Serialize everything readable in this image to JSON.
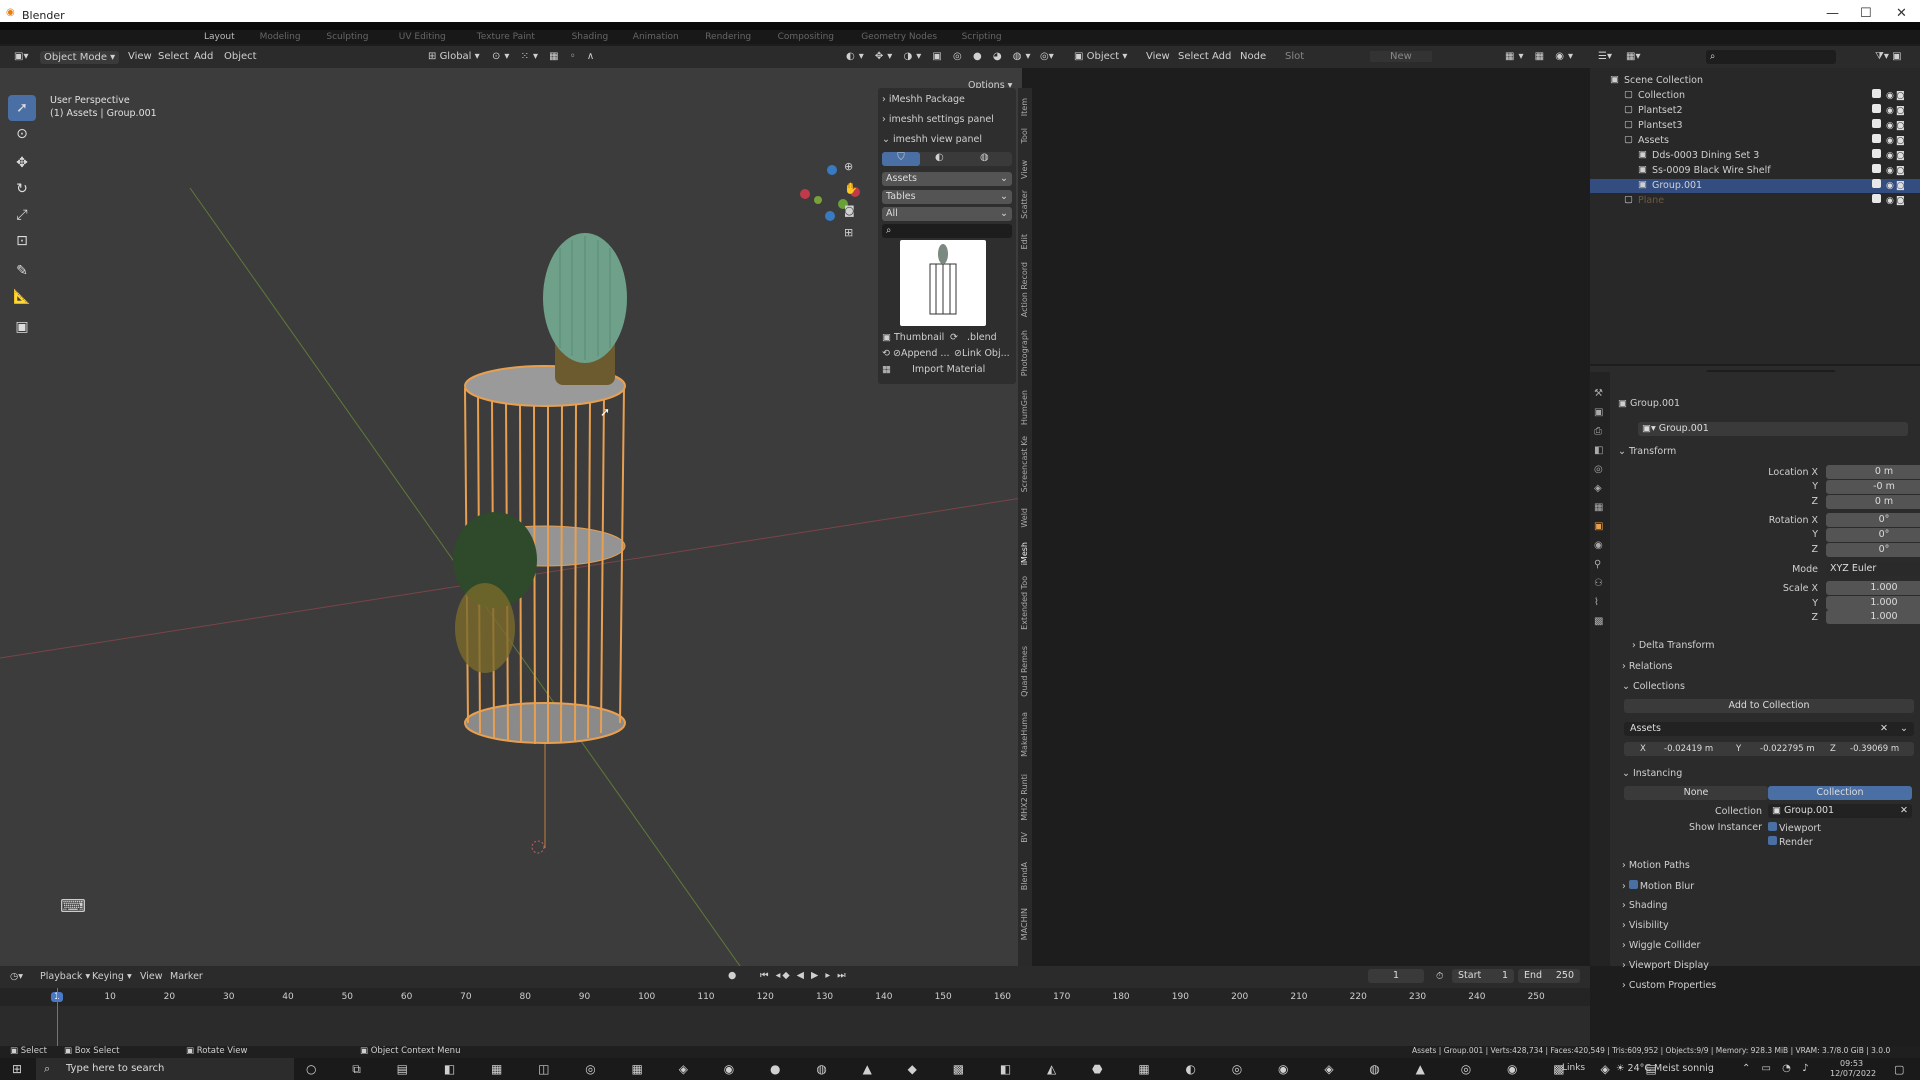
{
  "window": {
    "title": "Blender",
    "minimize": "—",
    "maximize": "☐",
    "close": "✕"
  },
  "workspace_tabs": [
    "Layout",
    "Modeling",
    "Sculpting",
    "UV Editing",
    "Texture Paint",
    "Shading",
    "Animation",
    "Rendering",
    "Compositing",
    "Geometry Nodes",
    "Scripting"
  ],
  "viewport_header": {
    "mode": "Object Mode",
    "menus": [
      "View",
      "Select",
      "Add",
      "Object"
    ],
    "transform": "Global",
    "options": "Options"
  },
  "viewport": {
    "perspective": "User Perspective",
    "context": "(1) Assets | Group.001"
  },
  "npanel": {
    "packages": [
      {
        "label": "iMeshh Package"
      },
      {
        "label": "imeshh settings panel"
      },
      {
        "label": "imeshh view panel"
      }
    ],
    "dropdowns": [
      "Assets",
      "Tables",
      "All"
    ],
    "thumb_label": "Thumbnail",
    "ext_label": ".blend",
    "append": "Append ...",
    "link": "Link Obj...",
    "import_material": "Import Material"
  },
  "side_tabs": [
    "Item",
    "Tool",
    "View",
    "Scatter",
    "Edit",
    "Action Record",
    "Photograph",
    "HumGen",
    "Screencast Ke",
    "Weld",
    "iMesh",
    "Extended Too",
    "Quad Remes",
    "MakeHuma",
    "MHX2 Runti",
    "BV",
    "BlendA",
    "MACHIN"
  ],
  "node_header": {
    "object": "Object",
    "menus": [
      "View",
      "Select",
      "Add",
      "Node"
    ],
    "slot": "Slot",
    "new": "New"
  },
  "outliner": {
    "items": [
      {
        "label": "Scene Collection",
        "indent": 0
      },
      {
        "label": "Collection",
        "indent": 1
      },
      {
        "label": "Plantset2",
        "indent": 1
      },
      {
        "label": "Plantset3",
        "indent": 1
      },
      {
        "label": "Assets",
        "indent": 1
      },
      {
        "label": "Dds-0003 Dining Set 3",
        "indent": 2
      },
      {
        "label": "Ss-0009 Black Wire Shelf",
        "indent": 2
      },
      {
        "label": "Group.001",
        "indent": 2,
        "selected": true
      },
      {
        "label": "Plane",
        "indent": 1
      }
    ]
  },
  "props": {
    "object_name": "Group.001",
    "datablock": "Group.001",
    "transform": "Transform",
    "loc_labels": [
      "Location X",
      "Y",
      "Z"
    ],
    "loc": [
      "0 m",
      "-0 m",
      "0 m"
    ],
    "rot_labels": [
      "Rotation X",
      "Y",
      "Z"
    ],
    "rot": [
      "0°",
      "0°",
      "0°"
    ],
    "mode_label": "Mode",
    "mode": "XYZ Euler",
    "scale_labels": [
      "Scale X",
      "Y",
      "Z"
    ],
    "scale": [
      "1.000",
      "1.000",
      "1.000"
    ],
    "delta": "Delta Transform",
    "relations": "Relations",
    "collections": "Collections",
    "add_collection": "Add to Collection",
    "coll_name": "Assets",
    "offset": {
      "x_label": "X",
      "x": "-0.02419 m",
      "y_label": "Y",
      "y": "-0.022795 m",
      "z_label": "Z",
      "z": "-0.39069 m"
    },
    "instancing": "Instancing",
    "inst_none": "None",
    "inst_collection": "Collection",
    "inst_coll_label": "Collection",
    "inst_coll_value": "Group.001",
    "show_instancer": "Show Instancer",
    "viewport": "Viewport",
    "render": "Render",
    "sections": [
      "Motion Paths",
      "Motion Blur",
      "Shading",
      "Visibility",
      "Wiggle Collider",
      "Viewport Display",
      "Custom Properties"
    ]
  },
  "timeline": {
    "menus": [
      "Playback",
      "Keying",
      "View",
      "Marker"
    ],
    "frame": "1",
    "start_label": "Start",
    "start": "1",
    "end_label": "End",
    "end": "250",
    "ticks": [
      "1",
      "10",
      "20",
      "30",
      "40",
      "50",
      "60",
      "70",
      "80",
      "90",
      "100",
      "110",
      "120",
      "130",
      "140",
      "150",
      "160",
      "170",
      "180",
      "190",
      "200",
      "210",
      "220",
      "230",
      "240",
      "250"
    ]
  },
  "status": {
    "select": "Select",
    "box": "Box Select",
    "rotate": "Rotate View",
    "ctx": "Object Context Menu",
    "stats": "Assets | Group.001 | Verts:428,734 | Faces:420,549 | Tris:609,952 | Objects:9/9 | Memory: 928.3 MiB | VRAM: 3.7/8.0 GiB | 3.0.0"
  },
  "taskbar": {
    "search": "Type here to search",
    "links": "Links",
    "weather": "24°C Meist sonnig",
    "time": "09:53",
    "date": "12/07/2022"
  },
  "colors": {
    "accent": "#4a6fa5",
    "selection": "#e8a050",
    "header": "#2b2b2b",
    "viewport": "#3c3c3c"
  }
}
